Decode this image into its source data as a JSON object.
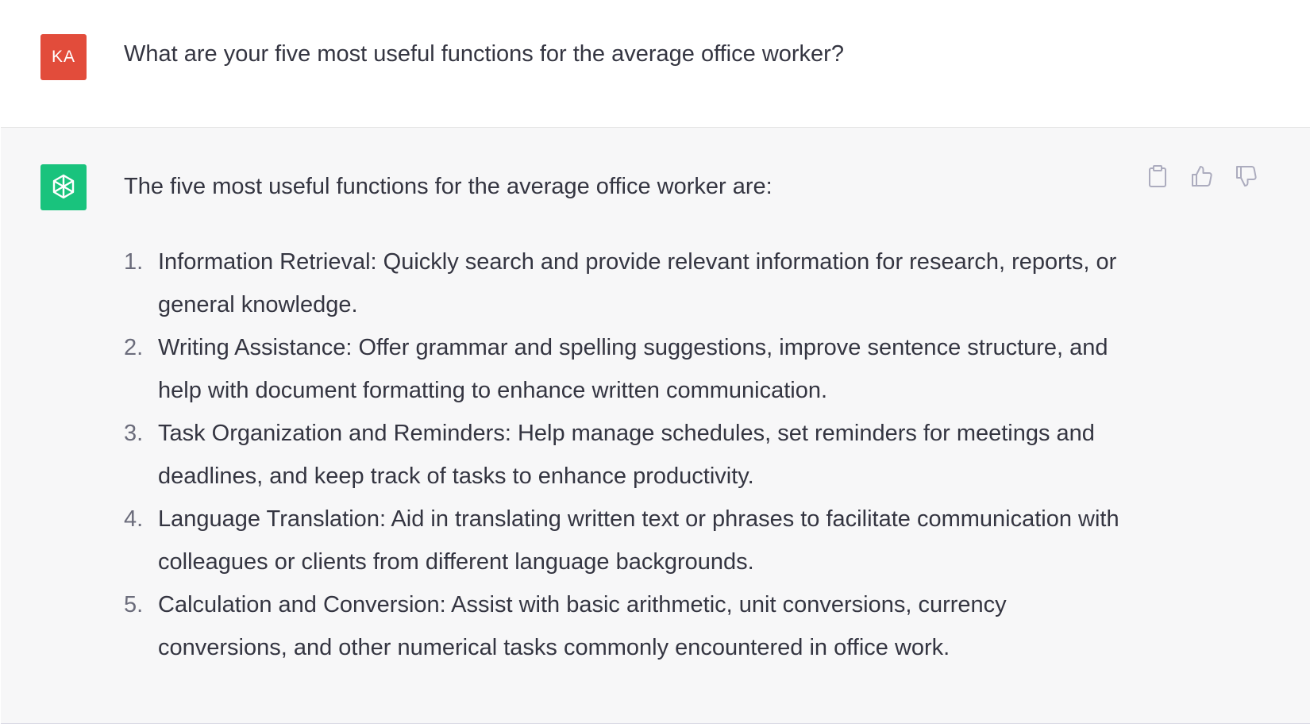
{
  "user": {
    "initials": "KA",
    "message": "What are your five most useful functions for the average office worker?"
  },
  "assistant": {
    "avatar_icon": "openai-logo-icon",
    "intro": "The five most useful functions for the average office worker are:",
    "items": [
      {
        "number": "1.",
        "text": "Information Retrieval: Quickly search and provide relevant information for research, reports, or general knowledge."
      },
      {
        "number": "2.",
        "text": "Writing Assistance: Offer grammar and spelling suggestions, improve sentence structure, and help with document formatting to enhance written communication."
      },
      {
        "number": "3.",
        "text": "Task Organization and Reminders: Help manage schedules, set reminders for meetings and deadlines, and keep track of tasks to enhance productivity."
      },
      {
        "number": "4.",
        "text": "Language Translation: Aid in translating written text or phrases to facilitate communication with colleagues or clients from different language backgrounds."
      },
      {
        "number": "5.",
        "text": "Calculation and Conversion: Assist with basic arithmetic, unit conversions, currency conversions, and other numerical tasks commonly encountered in office work."
      }
    ],
    "actions": [
      "clipboard-icon",
      "thumbs-up-icon",
      "thumbs-down-icon"
    ]
  },
  "colors": {
    "user_avatar": "#e24c3b",
    "bot_avatar": "#19c37d",
    "assistant_bg": "#f7f7f8",
    "text": "#343541"
  }
}
